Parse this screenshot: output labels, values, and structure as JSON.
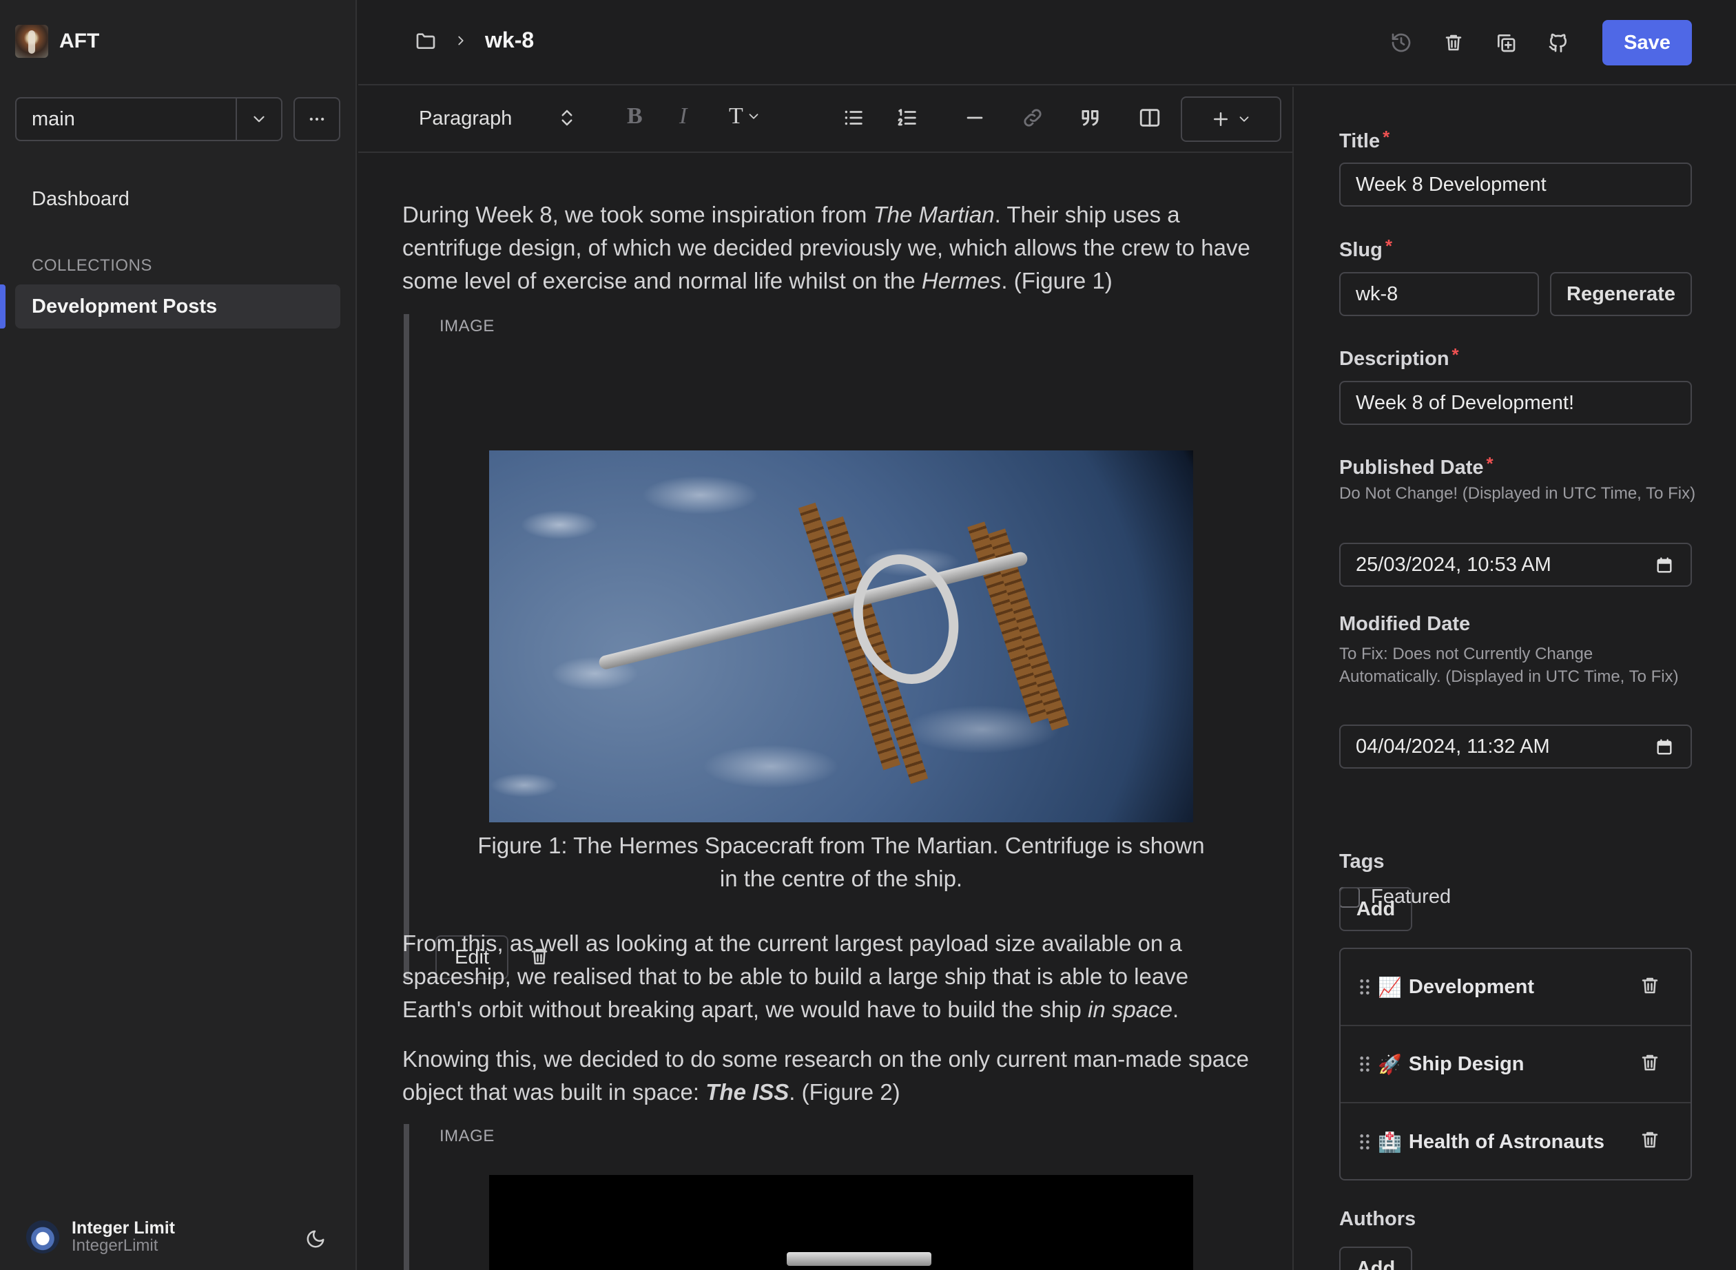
{
  "app": {
    "name": "AFT"
  },
  "sidebar": {
    "branch": "main",
    "dashboard": "Dashboard",
    "section_label": "COLLECTIONS",
    "active_collection": "Development Posts",
    "user": {
      "name": "Integer Limit",
      "handle": "IntegerLimit"
    }
  },
  "header": {
    "entry_title": "wk-8",
    "save_label": "Save"
  },
  "toolbar": {
    "block_type": "Paragraph",
    "bold": "B",
    "italic": "I",
    "text_style": "T"
  },
  "editor": {
    "p1": {
      "a": "During Week 8, we took some inspiration from ",
      "b": "The Martian",
      "c": ". Their ship uses a centrifuge design, of which we decided previously we, which allows the crew to have some level of exercise and normal life whilst on the ",
      "d": "Hermes",
      "e": ". (Figure 1)"
    },
    "image_label": "IMAGE",
    "figure1_caption": "Figure 1: The Hermes Spacecraft from The Martian. Centrifuge is shown in the centre of the ship.",
    "edit_label": "Edit",
    "p2": {
      "a": "From this, as well as looking at the current largest payload size available on a spaceship, we realised that to be able to build a large ship that is able to leave Earth's orbit without breaking apart, we would have to build the ship ",
      "b": "in space",
      "c": "."
    },
    "p3": {
      "a": "Knowing this, we decided to do some research on the only current man-made space object that was built in space: ",
      "b": "The ISS",
      "c": ". (Figure 2)"
    }
  },
  "form": {
    "title_label": "Title",
    "title_value": "Week 8 Development",
    "slug_label": "Slug",
    "slug_value": "wk-8",
    "regenerate_label": "Regenerate",
    "description_label": "Description",
    "description_value": "Week 8 of Development!",
    "published_label": "Published Date",
    "published_help": "Do Not Change! (Displayed in UTC Time, To Fix)",
    "published_value": "25/03/2024, 10:53 AM",
    "modified_label": "Modified Date",
    "modified_help": "To Fix: Does not Currently Change Automatically. (Displayed in UTC Time, To Fix)",
    "modified_value": "04/04/2024, 11:32 AM",
    "featured_label": "Featured",
    "required_mark": "*",
    "tags_label": "Tags",
    "add_label": "Add",
    "tags": [
      {
        "emoji": "📈",
        "name": "Development"
      },
      {
        "emoji": "🚀",
        "name": "Ship Design"
      },
      {
        "emoji": "🏥",
        "name": "Health of Astronauts"
      }
    ],
    "authors_label": "Authors"
  },
  "colors": {
    "accent": "#4f68e6",
    "required": "#f05252",
    "background": "#1e1e1f"
  }
}
